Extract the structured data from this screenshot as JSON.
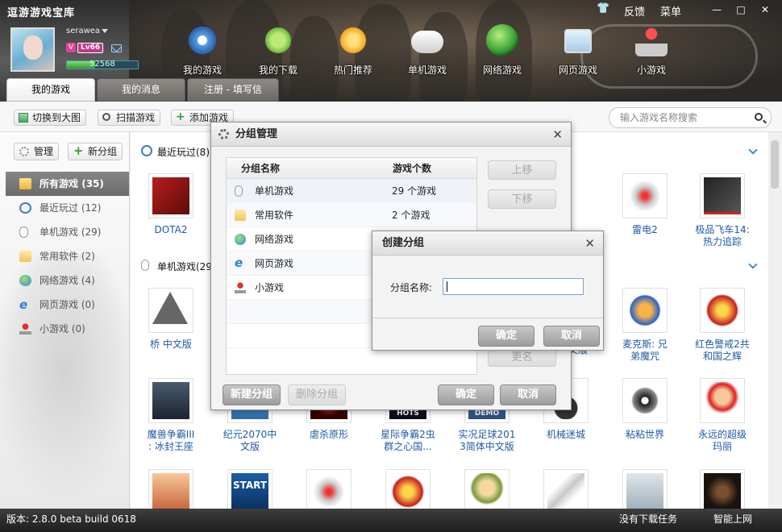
{
  "app_title": "逗游游戏宝库",
  "window": {
    "skin_label": "✿",
    "feedback": "反馈",
    "menu": "菜单",
    "minimize": "—",
    "restore": "□",
    "close": "✕"
  },
  "user": {
    "name": "serawea",
    "vip_badge": "V",
    "level": "Lv66",
    "xp_value": "52568"
  },
  "nav": [
    {
      "label": "我的游戏",
      "icon": "skull-ship-icon"
    },
    {
      "label": "我的下载",
      "icon": "download-icon"
    },
    {
      "label": "热门推荐",
      "icon": "hot-plus-icon"
    },
    {
      "label": "单机游戏",
      "icon": "gamepad-icon"
    },
    {
      "label": "网络游戏",
      "icon": "globe-icon"
    },
    {
      "label": "网页游戏",
      "icon": "browser-game-icon"
    },
    {
      "label": "小游戏",
      "icon": "joystick-icon"
    }
  ],
  "tabs": [
    "我的游戏",
    "我的消息",
    "注册 - 填写信息"
  ],
  "toolbar": {
    "switch_view": "切换到大图",
    "scan": "扫描游戏",
    "add": "添加游戏",
    "search_placeholder": "输入游戏名称搜索"
  },
  "sidebar": {
    "manage": "管理",
    "new_group": "新分组",
    "items": [
      {
        "label": "所有游戏",
        "count": "(35)"
      },
      {
        "label": "最近玩过",
        "count": "(12)"
      },
      {
        "label": "单机游戏",
        "count": "(29)"
      },
      {
        "label": "常用软件",
        "count": "(2)"
      },
      {
        "label": "网络游戏",
        "count": "(4)"
      },
      {
        "label": "网页游戏",
        "count": "(0)"
      },
      {
        "label": "小游戏",
        "count": "(0)"
      }
    ]
  },
  "main": {
    "section_recent": "最近玩过(8)",
    "section_single": "单机游戏(29",
    "recent_games": [
      {
        "name": "DOTA2"
      },
      {
        "name": "雷电2"
      },
      {
        "name": "极品飞车14:\n热力追踪"
      }
    ],
    "single_games_row1": [
      {
        "name": "桥 中文版"
      },
      {
        "name": "文版"
      },
      {
        "name": "麦克斯: 兄\n弟魔咒"
      },
      {
        "name": "红色警戒2共\n和国之辉"
      }
    ],
    "single_games_row2": [
      {
        "name": "魔兽争霸III\n: 冰封王座"
      },
      {
        "name": "纪元2070中\n文版"
      },
      {
        "name": "虐杀原形"
      },
      {
        "name": "星际争霸2虫\n群之心国..."
      },
      {
        "name": "实况足球201\n3简体中文版"
      },
      {
        "name": "机械迷城"
      },
      {
        "name": "粘粘世界"
      },
      {
        "name": "永远的超级\n玛丽"
      }
    ],
    "thumb_texts": {
      "hots": "HOTS",
      "demo": "DEMO",
      "start": "START"
    }
  },
  "group_dialog": {
    "title": "分组管理",
    "col_name": "分组名称",
    "col_count": "游戏个数",
    "rows": [
      {
        "name": "单机游戏",
        "count": "29 个游戏"
      },
      {
        "name": "常用软件",
        "count": "2 个游戏"
      },
      {
        "name": "网络游戏",
        "count": ""
      },
      {
        "name": "网页游戏",
        "count": ""
      },
      {
        "name": "小游戏",
        "count": ""
      }
    ],
    "move_up": "上移",
    "move_down": "下移",
    "rename": "更名",
    "new_group": "新建分组",
    "delete_group": "删除分组",
    "ok": "确定",
    "cancel": "取消"
  },
  "create_dialog": {
    "title": "创建分组",
    "label": "分组名称:",
    "ok": "确定",
    "cancel": "取消"
  },
  "status": {
    "version": "版本: 2.8.0 beta build 0618",
    "downloads": "没有下载任务",
    "network": "智能上网"
  }
}
